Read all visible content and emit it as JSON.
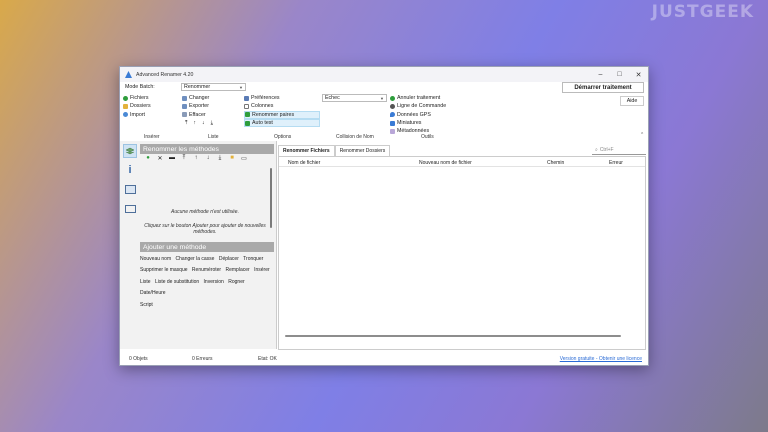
{
  "watermark": "JUSTGEEK",
  "window": {
    "title": "Advanced Renamer 4.20"
  },
  "batch": {
    "label": "Mode Batch:",
    "value": "Renommer"
  },
  "col1": [
    "Fichiers",
    "Dossiers",
    "Import"
  ],
  "col2": [
    "Changer",
    "Exporter",
    "Effacer"
  ],
  "col3": [
    "Préférences",
    "Colonnes",
    "Renommer paires",
    "Auto test"
  ],
  "echec_select": "Echec",
  "col5": [
    "Annuler traitement",
    "Ligne de Commande",
    "Données GPS",
    "Miniatures",
    "Métadonnées"
  ],
  "start_button": "Démarrer traitement",
  "help_button": "Aide",
  "ribbon_groups": [
    "Insérer",
    "Liste",
    "Options",
    "Collision de Nom",
    "Outils"
  ],
  "methods_header": "Renommer les méthodes",
  "empty_line1": "Aucune méthode n'est utilisée.",
  "empty_line2": "Cliquez sur le bouton Ajouter pour ajouter de nouvelles méthodes.",
  "add_header": "Ajouter une méthode",
  "methods": [
    "Nouveau nom",
    "Changer la casse",
    "Déplacer",
    "Tronquer",
    "Supprimer le masque",
    "Renuméroter",
    "Remplacer",
    "Insérer",
    "Liste",
    "Liste de substitution",
    "Inversion",
    "Rogner",
    "Date/Heure",
    "Script"
  ],
  "tabs": [
    "Renommer Fichiers",
    "Renommer Dossiers"
  ],
  "search_placeholder": "Ctrl+F",
  "columns": [
    "Nom de fichier",
    "Nouveau nom de fichier",
    "Chemin",
    "Erreur"
  ],
  "status": {
    "objects": "0 Objets",
    "errors": "0 Erreurs",
    "state": "Etat: OK",
    "license": "Version gratuite - Obtenir une licence"
  }
}
